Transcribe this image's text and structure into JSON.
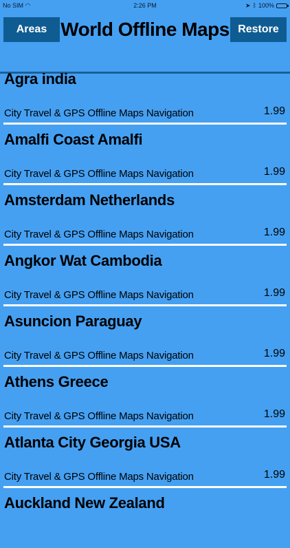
{
  "status_bar": {
    "carrier": "No SIM",
    "time": "2:26 PM",
    "battery": "100%"
  },
  "header": {
    "left_button": "Areas",
    "title": "World Offline Maps",
    "right_button": "Restore"
  },
  "items": [
    {
      "title": "Agra india",
      "subtitle": "City Travel & GPS Offline Maps Navigation",
      "price": "1.99"
    },
    {
      "title": "Amalfi Coast Amalfi",
      "subtitle": "City Travel & GPS Offline Maps Navigation",
      "price": "1.99"
    },
    {
      "title": "Amsterdam Netherlands",
      "subtitle": "City Travel & GPS Offline Maps Navigation",
      "price": "1.99"
    },
    {
      "title": "Angkor Wat Cambodia",
      "subtitle": "City Travel & GPS Offline Maps Navigation",
      "price": "1.99"
    },
    {
      "title": "Asuncion Paraguay",
      "subtitle": "City Travel & GPS Offline Maps Navigation",
      "price": "1.99"
    },
    {
      "title": "Athens Greece",
      "subtitle": "City Travel & GPS Offline Maps Navigation",
      "price": "1.99"
    },
    {
      "title": "Atlanta City Georgia USA",
      "subtitle": "City Travel & GPS Offline Maps Navigation",
      "price": "1.99"
    },
    {
      "title": "Auckland New Zealand"
    }
  ],
  "colors": {
    "background": "#45a0f2",
    "button": "#0f5c93",
    "divider": "#ffffff"
  }
}
